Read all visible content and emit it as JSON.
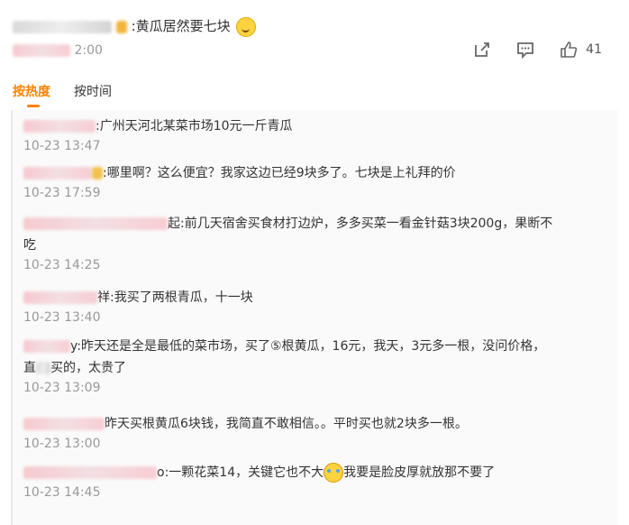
{
  "post": {
    "text": ":黄瓜居然要七块",
    "time": "2:00",
    "like_count": "41",
    "icons": [
      "share-icon",
      "comment-icon",
      "like-icon"
    ]
  },
  "tabs": [
    {
      "label": "按热度",
      "active": true
    },
    {
      "label": "按时间",
      "active": false
    }
  ],
  "comments": [
    {
      "text": ":广州天河北某菜市场10元一斤青瓜",
      "time": "10-23 13:47"
    },
    {
      "text": ":哪里啊？这么便宜？我家这边已经9块多了。七块是上礼拜的价",
      "time": "10-23 17:59"
    },
    {
      "text_line1": "起:前几天宿舍买食材打边炉，多多买菜一看金针菇3块200g，果断不",
      "text_line2": "吃",
      "time": "10-23 14:25"
    },
    {
      "text": "祥:我买了两根青瓜，十一块",
      "time": "10-23 13:40"
    },
    {
      "text_line1": "y:昨天还是全是最低的菜市场，买了⑤根黄瓜，16元，我天，3元多一根，没问价格，",
      "text_line2_a": "直",
      "text_line2_b": "买的，太贵了",
      "time": "10-23 13:09"
    },
    {
      "text": "昨天买根黄瓜6块钱，我简直不敢相信。。平时买也就2块多一根。",
      "time": "10-23 13:00"
    },
    {
      "text_a": "o:一颗花菜14，关键它也不大",
      "text_b": "我要是脸皮厚就放那不要了",
      "time": "10-23 14:45"
    }
  ],
  "colors": {
    "accent": "#ff8200",
    "muted": "#999999",
    "text": "#333333"
  }
}
